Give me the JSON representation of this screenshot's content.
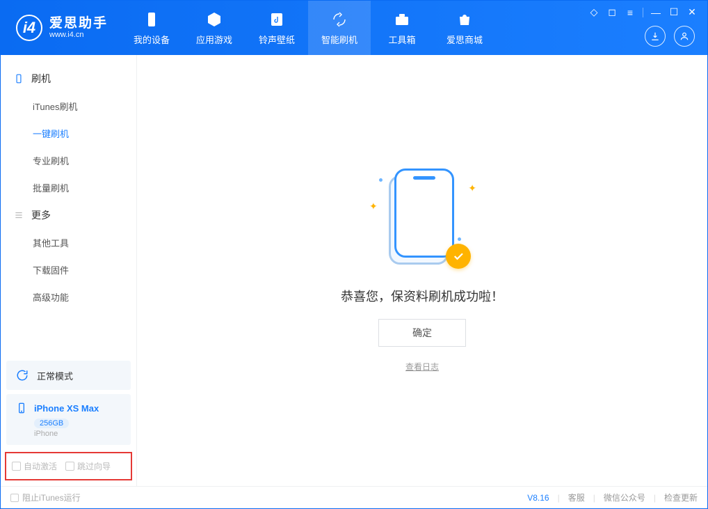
{
  "app": {
    "name": "爱思助手",
    "url": "www.i4.cn"
  },
  "tabs": {
    "device": "我的设备",
    "apps": "应用游戏",
    "ring": "铃声壁纸",
    "flash": "智能刷机",
    "tools": "工具箱",
    "store": "爱思商城"
  },
  "sidebar": {
    "section_flash": "刷机",
    "items": {
      "itunes": "iTunes刷机",
      "onekey": "一键刷机",
      "pro": "专业刷机",
      "batch": "批量刷机"
    },
    "section_more": "更多",
    "more": {
      "other": "其他工具",
      "firmware": "下载固件",
      "advanced": "高级功能"
    }
  },
  "mode_card": "正常模式",
  "device_card": {
    "name": "iPhone XS Max",
    "capacity": "256GB",
    "type": "iPhone"
  },
  "options": {
    "auto_activate": "自动激活",
    "skip_guide": "跳过向导"
  },
  "result": {
    "message": "恭喜您，保资料刷机成功啦！",
    "ok": "确定",
    "view_log": "查看日志"
  },
  "footer": {
    "block_itunes": "阻止iTunes运行",
    "version": "V8.16",
    "service": "客服",
    "wechat": "微信公众号",
    "update": "检查更新"
  }
}
